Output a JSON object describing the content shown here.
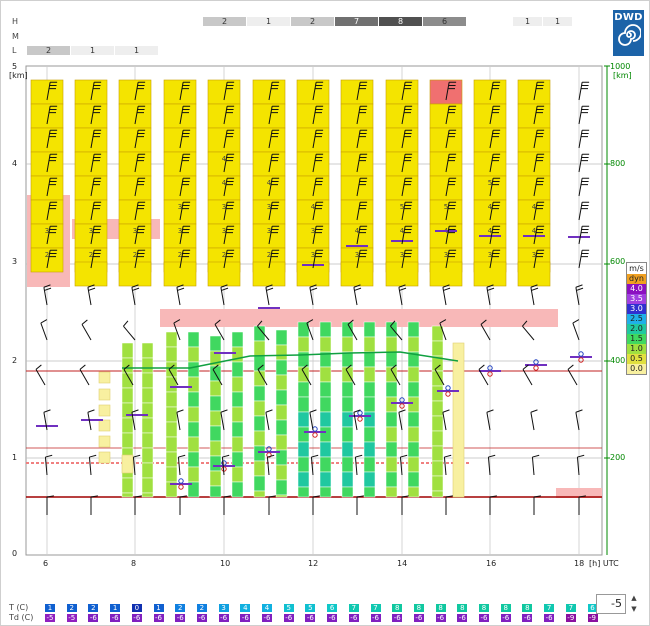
{
  "row_labels": [
    "H",
    "M",
    "L"
  ],
  "cloud_bars": {
    "high_left": [
      {
        "value": "2",
        "shade": "#c8c8c8"
      },
      {
        "value": "1",
        "shade": "#eeeeee"
      },
      {
        "value": "2",
        "shade": "#c8c8c8"
      },
      {
        "value": "7",
        "shade": "#707070"
      },
      {
        "value": "8",
        "shade": "#505050"
      },
      {
        "value": "6",
        "shade": "#8c8c8c"
      }
    ],
    "high_right": [
      {
        "value": "1",
        "shade": "#eeeeee"
      },
      {
        "value": "1",
        "shade": "#eeeeee"
      }
    ],
    "low": [
      {
        "value": "2",
        "shade": "#c8c8c8"
      },
      {
        "value": "1",
        "shade": "#eeeeee"
      },
      {
        "value": "1",
        "shade": "#eeeeee"
      }
    ]
  },
  "logo": {
    "text": "DWD"
  },
  "left_axis": {
    "unit": "[km]",
    "ticks": [
      "5",
      "4",
      "3",
      "2",
      "1",
      "0"
    ]
  },
  "right_axis": {
    "unit": "[km]",
    "ticks": [
      "1000",
      "800",
      "600",
      "400",
      "200"
    ],
    "color": "#008800"
  },
  "x_axis": {
    "ticks": [
      "6",
      "8",
      "10",
      "12",
      "14",
      "16",
      "18"
    ],
    "unit": "[h] UTC"
  },
  "legend": {
    "title": "m/s",
    "items": [
      {
        "label": "dyn",
        "color": "#f0a020"
      },
      {
        "label": "4.0",
        "color": "#8b10c0"
      },
      {
        "label": "3.5",
        "color": "#a040e0"
      },
      {
        "label": "3.0",
        "color": "#3030d0"
      },
      {
        "label": "2.5",
        "color": "#20b0e8"
      },
      {
        "label": "2.0",
        "color": "#20c8a0"
      },
      {
        "label": "1.5",
        "color": "#40d860"
      },
      {
        "label": "1.0",
        "color": "#a0e040"
      },
      {
        "label": "0.5",
        "color": "#e0e040"
      },
      {
        "label": "0.0",
        "color": "#f8f0a0"
      }
    ]
  },
  "upper_cloud_numbers": [
    [
      "3",
      "2"
    ],
    [
      "3",
      "2"
    ],
    [
      "3",
      "2"
    ],
    [
      "3",
      "3",
      "2"
    ],
    [
      "4",
      "4",
      "3",
      "3",
      "2"
    ],
    [
      "4",
      "3",
      "3",
      "2"
    ],
    [
      "4",
      "3",
      "3"
    ],
    [
      "4",
      "3"
    ],
    [
      "5",
      "4",
      "3"
    ],
    [
      "5",
      "4",
      "3"
    ],
    [
      "5",
      "4",
      "4",
      "3"
    ],
    [
      "4",
      "4",
      "3"
    ]
  ],
  "footer": {
    "t_label": "T",
    "t_unit": "(C)",
    "td_label": "Td",
    "td_unit": "(C)",
    "t_values": [
      "1",
      "2",
      "2",
      "1",
      "0",
      "1",
      "2",
      "2",
      "3",
      "4",
      "4",
      "5",
      "5",
      "6",
      "7",
      "7",
      "8",
      "8",
      "8",
      "8",
      "8",
      "8",
      "8",
      "7",
      "7",
      "6"
    ],
    "t_colors": [
      "#1060d0",
      "#1060d0",
      "#1060d0",
      "#1060d0",
      "#1030b0",
      "#1060d0",
      "#1080e0",
      "#1080e0",
      "#10a0e0",
      "#10b0e0",
      "#10b0e0",
      "#10c0d0",
      "#10c0d0",
      "#10c8c8",
      "#10c8b0",
      "#10c8b0",
      "#10c8a0",
      "#10c8a0",
      "#10c8a0",
      "#10c8a0",
      "#10c8a0",
      "#10c8a0",
      "#10c8a0",
      "#10c8b0",
      "#10c8b0",
      "#10c8c8"
    ],
    "td_values": [
      "-5",
      "-5",
      "-6",
      "-6",
      "-6",
      "-6",
      "-6",
      "-6",
      "-6",
      "-6",
      "-6",
      "-6",
      "-6",
      "-6",
      "-6",
      "-6",
      "-6",
      "-6",
      "-6",
      "-6",
      "-6",
      "-6",
      "-6",
      "-6",
      "-9",
      "-9"
    ],
    "td_colors": [
      "#9020c0",
      "#9020c0",
      "#8020c0",
      "#8020c0",
      "#8020c0",
      "#8020c0",
      "#8020c0",
      "#8020c0",
      "#8020c0",
      "#8020c0",
      "#8020c0",
      "#8020c0",
      "#8020c0",
      "#8020c0",
      "#8020c0",
      "#8020c0",
      "#8020c0",
      "#8020c0",
      "#8020c0",
      "#8020c0",
      "#8020c0",
      "#8020c0",
      "#8020c0",
      "#8020c0",
      "#8a10a0",
      "#8a10a0"
    ]
  },
  "offset_spinner": {
    "value": "-5"
  }
}
